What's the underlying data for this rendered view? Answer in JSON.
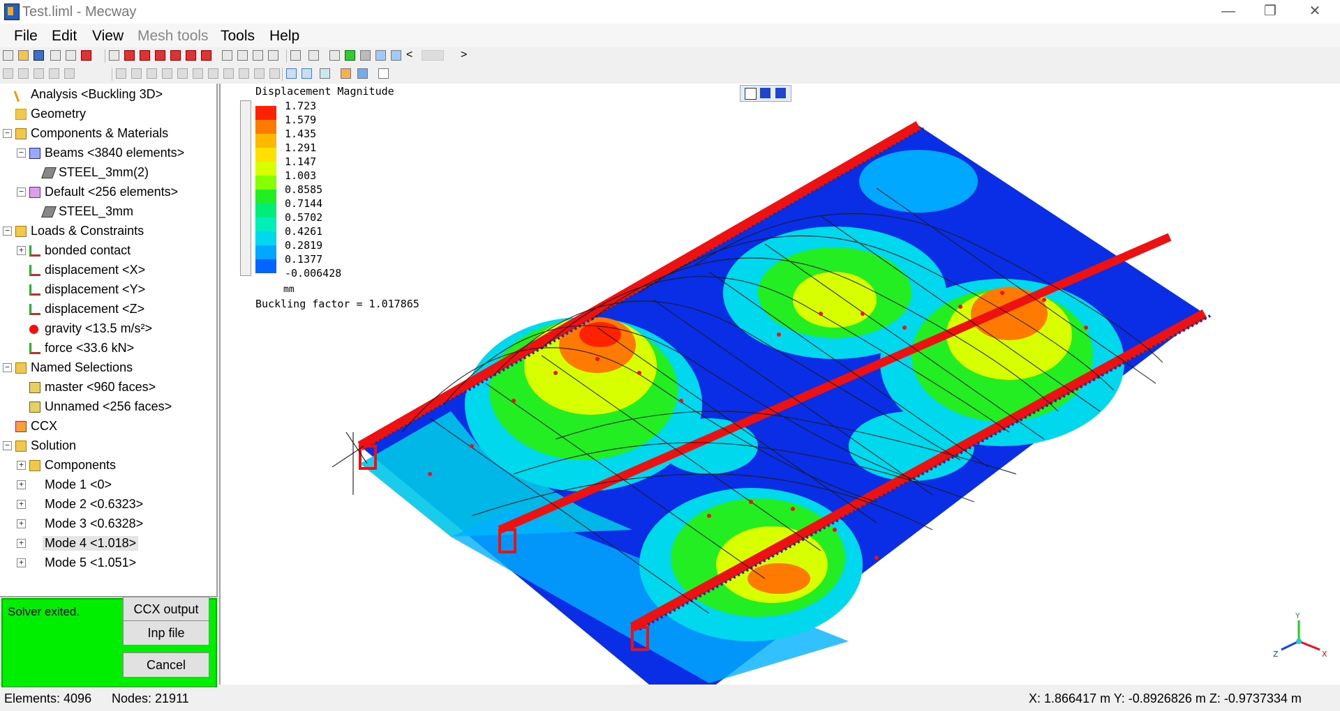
{
  "window": {
    "title": "Test.liml - Mecway",
    "minimize": "—",
    "restore": "❐",
    "close": "✕"
  },
  "menu": [
    {
      "label": "File",
      "disabled": false
    },
    {
      "label": "Edit",
      "disabled": false
    },
    {
      "label": "View",
      "disabled": false
    },
    {
      "label": "Mesh tools",
      "disabled": true
    },
    {
      "label": "Tools",
      "disabled": false
    },
    {
      "label": "Help",
      "disabled": false
    }
  ],
  "toolbar": {
    "nav_prev": "<",
    "nav_next": ">"
  },
  "tree": [
    {
      "label": "Analysis <Buckling 3D>",
      "icon": "analysis-icon",
      "exp": ""
    },
    {
      "label": "Geometry",
      "icon": "folder-icon",
      "exp": ""
    },
    {
      "label": "Components & Materials",
      "icon": "components-icon",
      "exp": "−"
    },
    {
      "label": "Beams <3840 elements>",
      "icon": "beam-icon",
      "exp": "−"
    },
    {
      "label": "STEEL_3mm(2)",
      "icon": "material-icon",
      "exp": ""
    },
    {
      "label": "Default <256 elements>",
      "icon": "component-icon",
      "exp": "−"
    },
    {
      "label": "STEEL_3mm",
      "icon": "material-icon",
      "exp": ""
    },
    {
      "label": "Loads & Constraints",
      "icon": "loads-icon",
      "exp": "−"
    },
    {
      "label": "bonded contact",
      "icon": "contact-icon",
      "exp": "+"
    },
    {
      "label": "displacement <X>",
      "icon": "displacement-icon",
      "exp": ""
    },
    {
      "label": "displacement <Y>",
      "icon": "displacement-icon",
      "exp": ""
    },
    {
      "label": "displacement <Z>",
      "icon": "displacement-icon",
      "exp": ""
    },
    {
      "label": "gravity <13.5 m/s²>",
      "icon": "gravity-icon",
      "exp": ""
    },
    {
      "label": "force <33.6 kN>",
      "icon": "force-icon",
      "exp": ""
    },
    {
      "label": "Named Selections",
      "icon": "named-selections-icon",
      "exp": "−"
    },
    {
      "label": "master <960 faces>",
      "icon": "selection-icon",
      "exp": ""
    },
    {
      "label": "Unnamed <256 faces>",
      "icon": "selection-icon",
      "exp": ""
    },
    {
      "label": "CCX",
      "icon": "ccx-icon",
      "exp": ""
    },
    {
      "label": "Solution",
      "icon": "solution-icon",
      "exp": "−"
    },
    {
      "label": "Components",
      "icon": "components-icon",
      "exp": "+"
    },
    {
      "label": "Mode 1 <0>",
      "icon": "",
      "exp": "+"
    },
    {
      "label": "Mode 2 <0.6323>",
      "icon": "",
      "exp": "+"
    },
    {
      "label": "Mode 3 <0.6328>",
      "icon": "",
      "exp": "+"
    },
    {
      "label": "Mode 4 <1.018>",
      "icon": "",
      "exp": "+",
      "selected": true
    },
    {
      "label": "Mode 5 <1.051>",
      "icon": "",
      "exp": "+"
    }
  ],
  "solver": {
    "status": "Solver exited.",
    "ccx_output": "CCX output",
    "inp_file": "Inp file",
    "cancel": "Cancel"
  },
  "legend": {
    "title": "Displacement Magnitude",
    "values": [
      "1.723",
      "1.579",
      "1.435",
      "1.291",
      "1.147",
      "1.003",
      "0.8585",
      "0.7144",
      "0.5702",
      "0.4261",
      "0.2819",
      "0.1377",
      "-0.006428"
    ],
    "colors": [
      "#ff2200",
      "#ff7a00",
      "#ffb800",
      "#ffe000",
      "#d8ff00",
      "#88ff00",
      "#22ee22",
      "#00ee77",
      "#00eeb8",
      "#00d8ee",
      "#00a8ff",
      "#0066ff",
      "#0022ee"
    ],
    "unit": "mm",
    "buckling": "Buckling factor = 1.017865"
  },
  "status": {
    "elements": "Elements:  4096",
    "nodes": "Nodes: 21911",
    "coords": "X: 1.866417 m Y: -0.8926826 m Z: -0.9737334 m"
  },
  "colors": {
    "solver_bg": "#00ee00",
    "mesh_blue": "#0a2ee6",
    "beam_red": "#ee1111"
  }
}
